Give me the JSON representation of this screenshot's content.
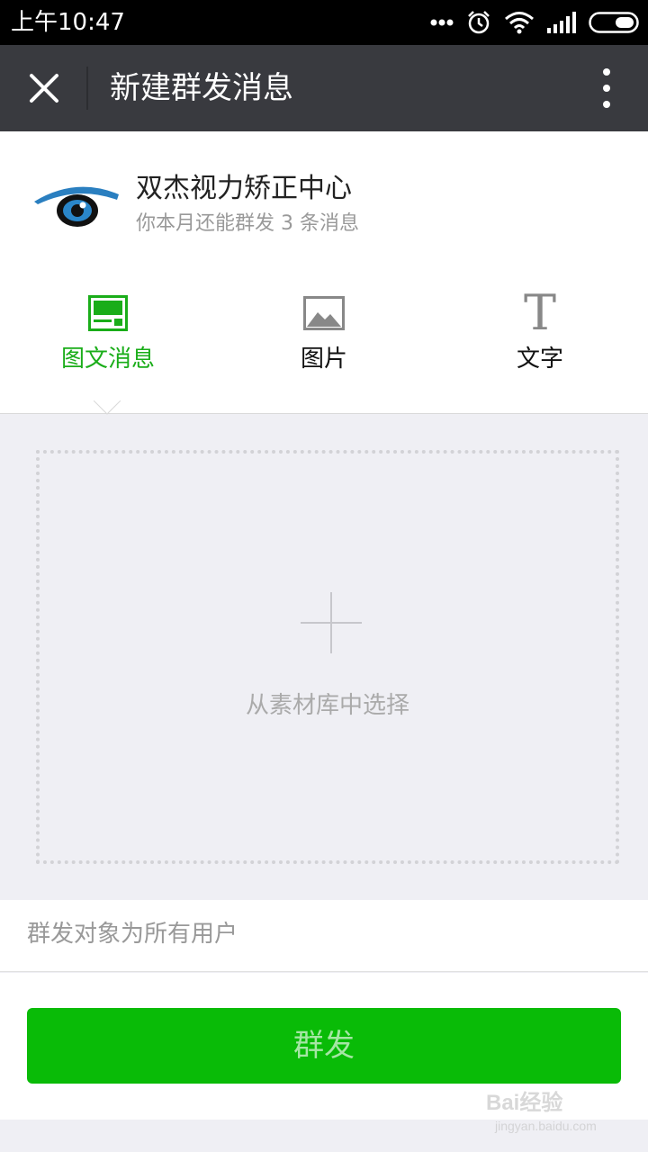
{
  "status_bar": {
    "time": "上午10:47",
    "icons": [
      "more-dots-icon",
      "alarm-clock-icon",
      "wifi-icon",
      "cellular-signal-icon",
      "battery-icon"
    ]
  },
  "app_bar": {
    "title": "新建群发消息",
    "close_icon": "close-icon",
    "more_icon": "more-vertical-icon",
    "background": "#393a3f"
  },
  "account": {
    "name": "双杰视力矫正中心",
    "quota_text": "你本月还能群发 3 条消息",
    "avatar_icon": "eye-logo"
  },
  "tabs": [
    {
      "label": "图文消息",
      "icon": "article-icon",
      "active": true
    },
    {
      "label": "图片",
      "icon": "image-icon",
      "active": false
    },
    {
      "label": "文字",
      "icon": "text-icon",
      "glyph": "T",
      "active": false
    }
  ],
  "picker": {
    "label": "从素材库中选择",
    "icon": "plus-icon"
  },
  "target": {
    "label": "群发对象为所有用户"
  },
  "send_button": {
    "label": "群发",
    "color": "#09bb07"
  },
  "watermark": {
    "main": "Bai经验",
    "sub": "jingyan.baidu.com"
  },
  "colors": {
    "accent_green": "#1aad19",
    "page_background": "#efeff4"
  }
}
